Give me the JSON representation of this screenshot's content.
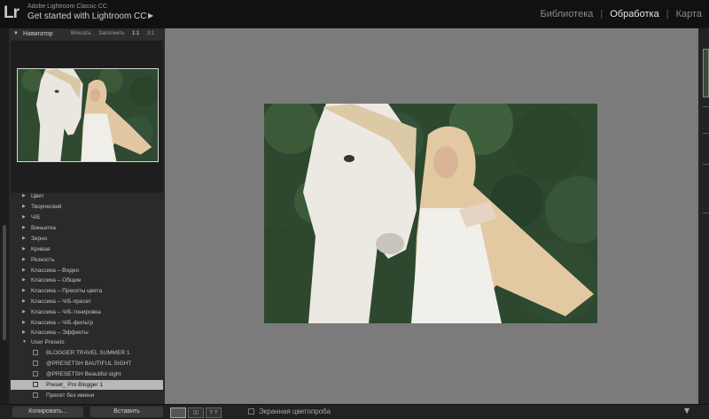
{
  "app": {
    "logo": "Lr",
    "product": "Adobe Lightroom Classic CC",
    "subtitle": "Get started with Lightroom CC",
    "subtitle_arrow": "▶"
  },
  "modules": [
    "Библиотека",
    "Обработка",
    "Карта"
  ],
  "active_module": "Обработка",
  "navigator": {
    "title": "Навигатор",
    "zoom_options": [
      "Вписать",
      "Заполнить",
      "1:1",
      "3:1"
    ]
  },
  "presets": [
    {
      "label": "Цвет",
      "expanded": false
    },
    {
      "label": "Творческий",
      "expanded": false
    },
    {
      "label": "Ч/Б",
      "expanded": false
    },
    {
      "label": "Виньетка",
      "expanded": false
    },
    {
      "label": "Зерно",
      "expanded": false
    },
    {
      "label": "Кривая",
      "expanded": false
    },
    {
      "label": "Резкость",
      "expanded": false
    },
    {
      "label": "Классика – Видео",
      "expanded": false
    },
    {
      "label": "Классика – Общие",
      "expanded": false
    },
    {
      "label": "Классика – Пресеты цвета",
      "expanded": false
    },
    {
      "label": "Классика – Ч/Б-пресет",
      "expanded": false
    },
    {
      "label": "Классика – Ч/Б-тонировка",
      "expanded": false
    },
    {
      "label": "Классика – Ч/Б-фильтр",
      "expanded": false
    },
    {
      "label": "Классика – Эффекты",
      "expanded": false
    },
    {
      "label": "User Presets",
      "expanded": true
    }
  ],
  "user_presets": [
    {
      "label": "BLOGGER TRAVEL SUMMER 1",
      "selected": false
    },
    {
      "label": "@PRESETSH BAUTIFUL SIGHT",
      "selected": false
    },
    {
      "label": "@PRESETSH Beautiful sight",
      "selected": false
    },
    {
      "label": "Preset_ Pro Blogger 1",
      "selected": true
    },
    {
      "label": "Пресет без имени",
      "selected": false
    }
  ],
  "bottom": {
    "copy_label": "Копировать...",
    "paste_label": "Вставить",
    "softproof_label": "Экранная цветопроба"
  },
  "colors": {
    "canvas": "#7b7b7b",
    "selected_preset": "#b8b8b8",
    "active_module": "#e6e6e6"
  }
}
